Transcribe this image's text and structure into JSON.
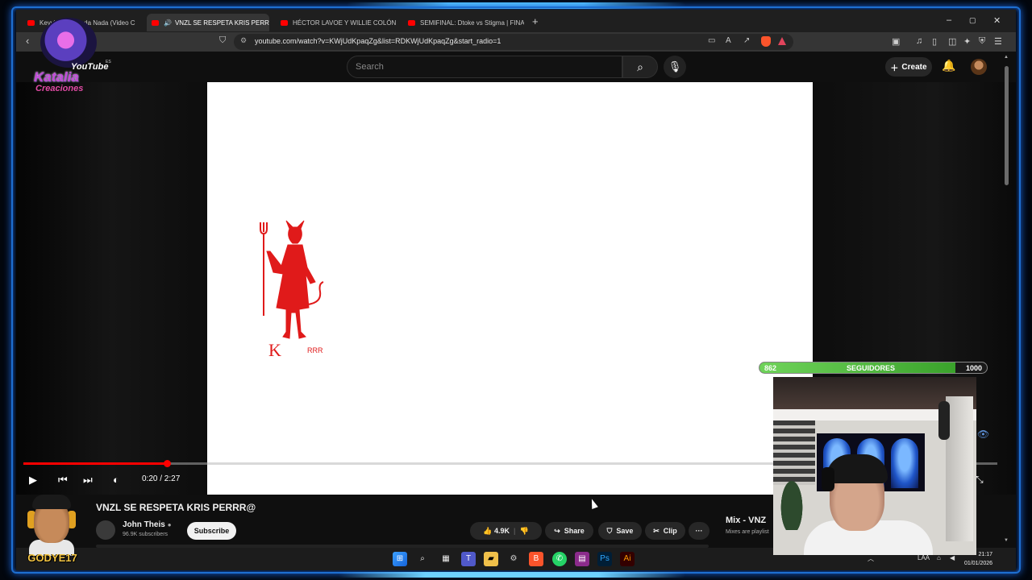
{
  "browser": {
    "tabs": [
      {
        "label": "Keyvin - ... Queda Nada (Video C",
        "active": false
      },
      {
        "label": "VNZL SE RESPETA KRIS PERR",
        "active": true
      },
      {
        "label": "HÉCTOR LAVOE Y WILLIE COLÓN 🌹",
        "active": false
      },
      {
        "label": "SEMIFINAL: Dtoke vs Stigma | FINAL",
        "active": false
      }
    ],
    "new_tab": "+",
    "url": "youtube.com/watch?v=KWjUdKpaqZg&list=RDKWjUdKpaqZg&start_radio=1",
    "window_controls": [
      "–",
      "▢",
      "✕"
    ]
  },
  "youtube": {
    "search_placeholder": "Search",
    "create_label": "Create",
    "player": {
      "progress_fraction": 0.147,
      "timecode": "0:20 / 2:27",
      "video_text": "K",
      "video_text2": "RRR"
    },
    "video": {
      "title": "VNZL SE RESPETA KRIS PERRR@",
      "channel": "John Theis",
      "subscribers": "96.9K subscribers",
      "subscribe_label": "Subscribe",
      "likes": "4.9K",
      "share_label": "Share",
      "save_label": "Save",
      "clip_label": "Clip",
      "more_label": "···"
    },
    "mix": {
      "title": "Mix - VNZ",
      "subtitle": "Mixes are playlist"
    }
  },
  "overlay": {
    "logo_youtube": "YouTube",
    "logo_name": "Katalia",
    "logo_sub": "Creaciones",
    "logo_es": "ES",
    "followers_current": "862",
    "followers_label": "SEGUIDORES",
    "followers_goal": "1000",
    "followers_fraction": 0.862,
    "streamer_tag": "GODYE17"
  },
  "taskbar": {
    "tray_lang": "LAA",
    "time": "21:17",
    "date": "01/01/2026"
  },
  "colors": {
    "accent_red": "#ff0000",
    "frame_blue": "#1d6fd1",
    "follow_green": "#4bb83a"
  }
}
